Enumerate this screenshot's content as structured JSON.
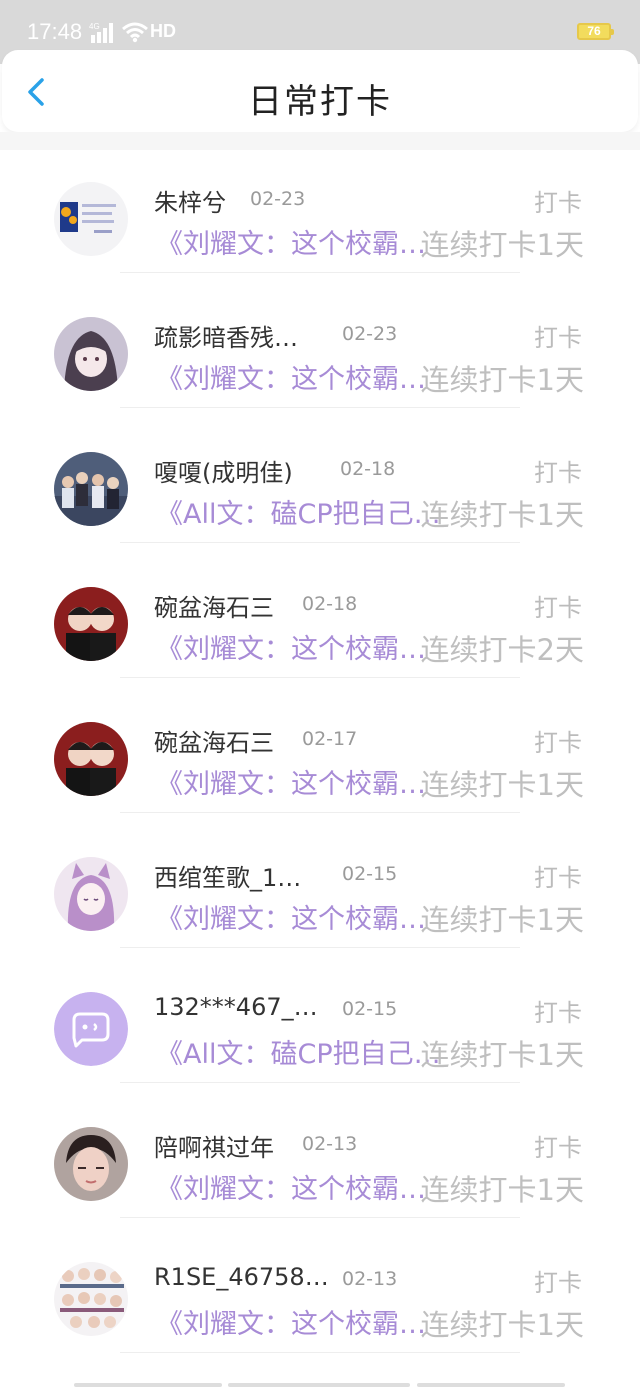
{
  "status": {
    "time": "17:48",
    "network": "4G",
    "hd": "HD",
    "battery": "76"
  },
  "header": {
    "title": "日常打卡"
  },
  "entries": [
    {
      "name": "朱梓兮",
      "date": "02-23",
      "label": "打卡",
      "book": "《刘耀文：这个校霸…",
      "streak": "连续打卡1天",
      "avatar": "blue-book-cover"
    },
    {
      "name": "疏影暗香残…",
      "date": "02-23",
      "label": "打卡",
      "book": "《刘耀文：这个校霸…",
      "streak": "连续打卡1天",
      "avatar": "anime-girl"
    },
    {
      "name": "嗄嗄(成明佳)",
      "date": "02-18",
      "label": "打卡",
      "book": "《All文：磕CP把自己…",
      "streak": "连续打卡1天",
      "avatar": "group-photo"
    },
    {
      "name": "碗盆海石三",
      "date": "02-18",
      "label": "打卡",
      "book": "《刘耀文：这个校霸…",
      "streak": "连续打卡2天",
      "avatar": "two-boys"
    },
    {
      "name": "碗盆海石三",
      "date": "02-17",
      "label": "打卡",
      "book": "《刘耀文：这个校霸…",
      "streak": "连续打卡1天",
      "avatar": "two-boys"
    },
    {
      "name": "西绾笙歌_1…",
      "date": "02-15",
      "label": "打卡",
      "book": "《刘耀文：这个校霸…",
      "streak": "连续打卡1天",
      "avatar": "anime-cat-girl"
    },
    {
      "name": "132***467_…",
      "date": "02-15",
      "label": "打卡",
      "book": "《All文：磕CP把自己…",
      "streak": "连续打卡1天",
      "avatar": "default-chat"
    },
    {
      "name": "陪啊祺过年",
      "date": "02-13",
      "label": "打卡",
      "book": "《刘耀文：这个校霸…",
      "streak": "连续打卡1天",
      "avatar": "boy-portrait"
    },
    {
      "name": "R1SE_46758…",
      "date": "02-13",
      "label": "打卡",
      "book": "《刘耀文：这个校霸…",
      "streak": "连续打卡1天",
      "avatar": "group-grid"
    }
  ],
  "colors": {
    "accent": "#a78bd6",
    "back": "#2aa2e8"
  }
}
